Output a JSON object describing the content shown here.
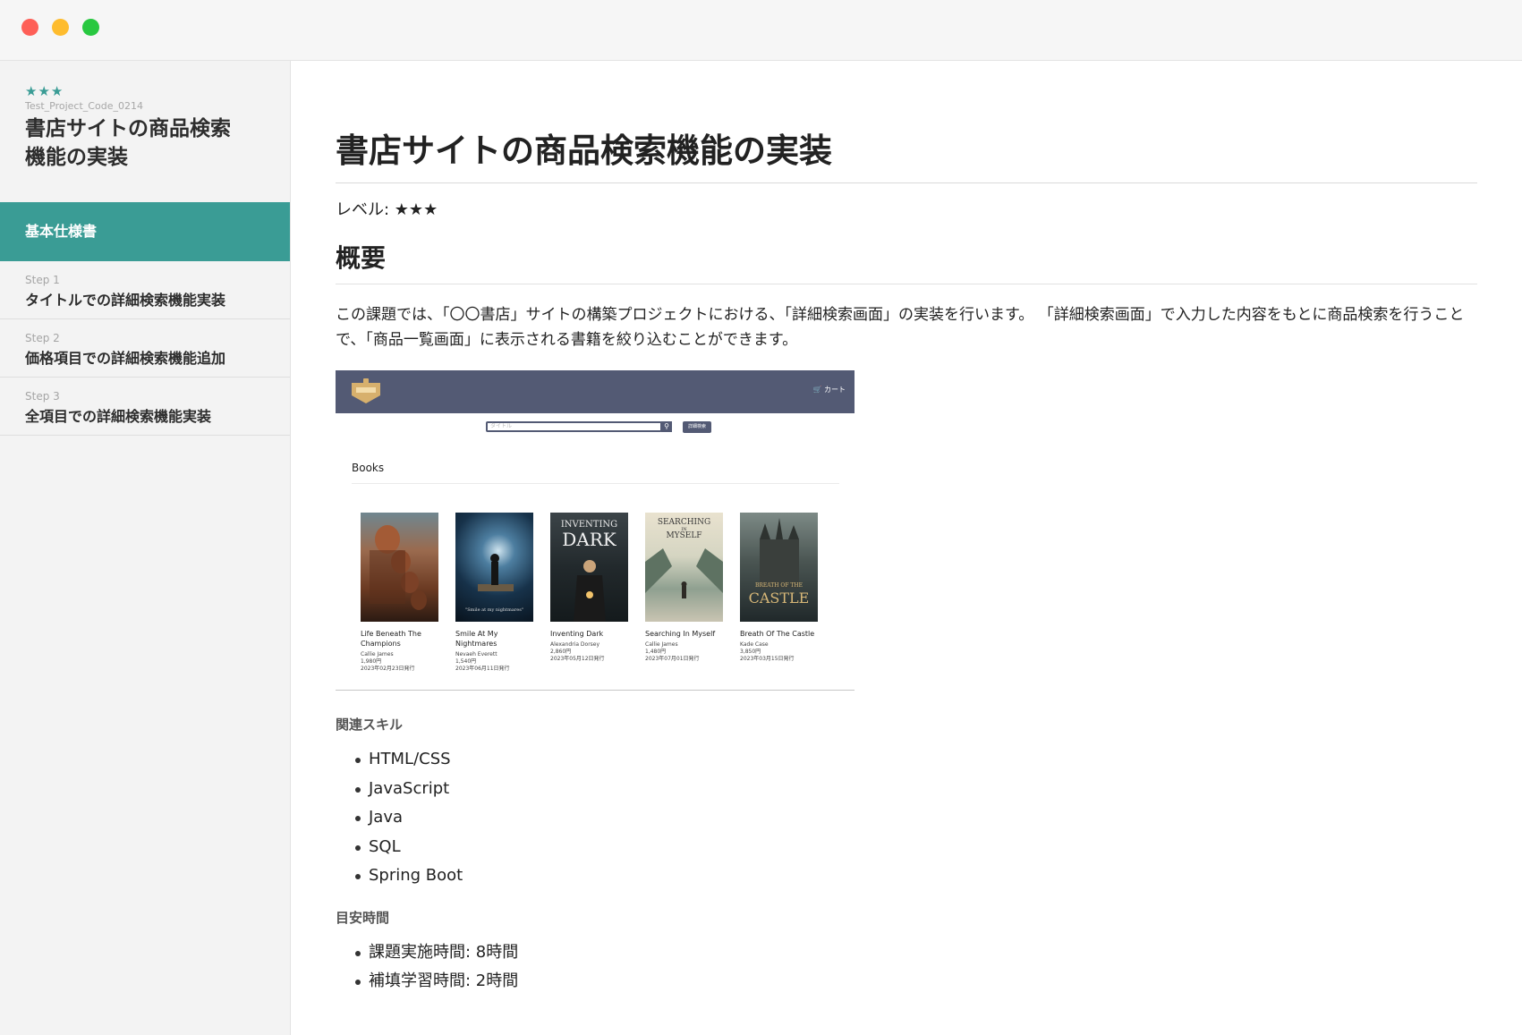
{
  "sidebar": {
    "stars": "★★★",
    "project_code": "Test_Project_Code_0214",
    "title": "書店サイトの商品検索機能の実装",
    "active_item": "基本仕様書",
    "steps": [
      {
        "num": "Step 1",
        "label": "タイトルでの詳細検索機能実装"
      },
      {
        "num": "Step 2",
        "label": "価格項目での詳細検索機能追加"
      },
      {
        "num": "Step 3",
        "label": "全項目での詳細検索機能実装"
      }
    ]
  },
  "main": {
    "title": "書店サイトの商品検索機能の実装",
    "level_label": "レベル: ",
    "level_stars": "★★★",
    "overview_heading": "概要",
    "overview_text": "この課題では、「〇〇書店」サイトの構築プロジェクトにおける、「詳細検索画面」の実装を行います。 「詳細検索画面」で入力した内容をもとに商品検索を行うことで、「商品一覧画面」に表示される書籍を絞り込むことができます。",
    "screenshot": {
      "cart_label": "🛒 カート",
      "search_placeholder": "タイトル",
      "advanced_button": "詳細検索",
      "section_title": "Books",
      "books": [
        {
          "title": "Life Beneath The Champions",
          "author": "Callie James",
          "price": "1,980円",
          "date": "2023年02月23日発行"
        },
        {
          "title": "Smile At My Nightmares",
          "author": "Nevaeh Everett",
          "price": "1,540円",
          "date": "2023年06月11日発行",
          "cover_text": "\"Smile at my nightmares\""
        },
        {
          "title": "Inventing Dark",
          "author": "Alexandria Dorsey",
          "price": "2,860円",
          "date": "2023年05月12日発行",
          "cover_text_1": "INVENTING",
          "cover_text_2": "DARK"
        },
        {
          "title": "Searching In Myself",
          "author": "Callie James",
          "price": "1,480円",
          "date": "2023年07月01日発行",
          "cover_text_1": "SEARCHING",
          "cover_text_2": "IN",
          "cover_text_3": "MYSELF"
        },
        {
          "title": "Breath Of The Castle",
          "author": "Kade Case",
          "price": "3,850円",
          "date": "2023年03月15日発行",
          "cover_text_1": "BREATH OF THE",
          "cover_text_2": "CASTLE"
        }
      ]
    },
    "skills_heading": "関連スキル",
    "skills": [
      "HTML/CSS",
      "JavaScript",
      "Java",
      "SQL",
      "Spring Boot"
    ],
    "time_heading": "目安時間",
    "times": [
      "課題実施時間: 8時間",
      "補填学習時間: 2時間"
    ]
  }
}
